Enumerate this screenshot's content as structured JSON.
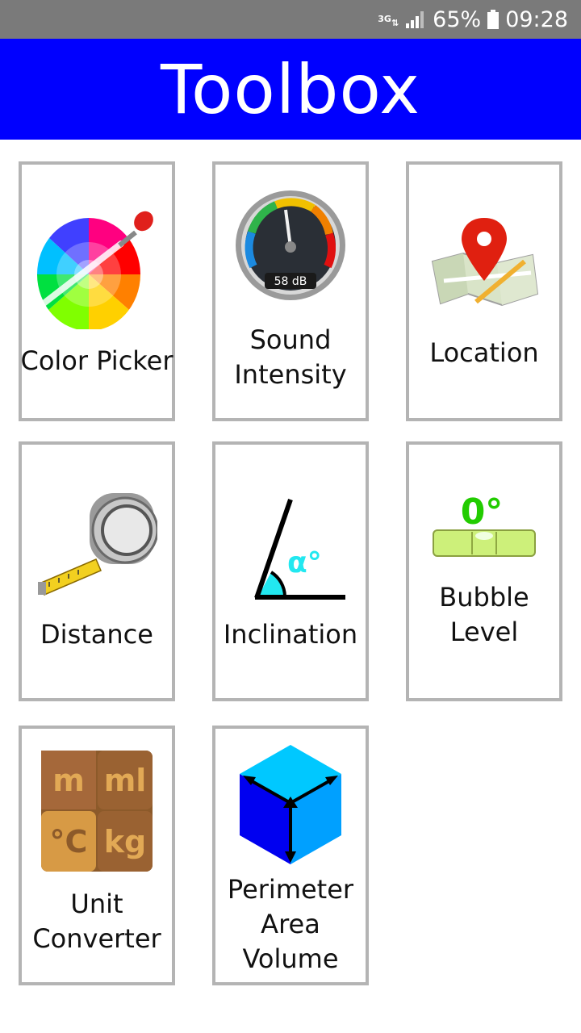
{
  "status_bar": {
    "network": "3G",
    "battery_percent": "65%",
    "time": "09:28"
  },
  "app_bar": {
    "title": "Toolbox"
  },
  "tools": [
    {
      "label": "Color Picker",
      "icon": "color-picker-icon"
    },
    {
      "label": "Sound\nIntensity",
      "icon": "sound-meter-icon",
      "meter_reading": "58 dB"
    },
    {
      "label": "Location",
      "icon": "map-pin-icon"
    },
    {
      "label": "Distance",
      "icon": "tape-measure-icon"
    },
    {
      "label": "Inclination",
      "icon": "angle-icon",
      "angle_symbol": "α°"
    },
    {
      "label": "Bubble\nLevel",
      "icon": "bubble-level-icon",
      "level_reading": "0°"
    },
    {
      "label": "Unit\nConverter",
      "icon": "unit-converter-icon",
      "units": [
        "m",
        "ml",
        "°C",
        "kg"
      ]
    },
    {
      "label": "Perimeter\nArea\nVolume",
      "icon": "cube-icon"
    }
  ],
  "colors": {
    "status_bar": "#7a7a7a",
    "app_bar": "#0000ff",
    "tile_border": "#b4b4b4",
    "bubble_reading": "#22cc00",
    "angle_fill": "#22e8f0"
  }
}
